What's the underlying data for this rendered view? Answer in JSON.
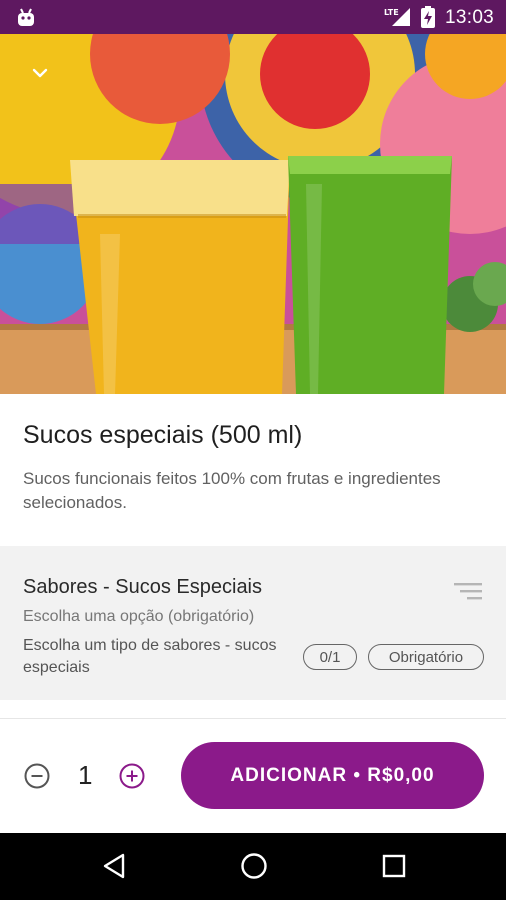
{
  "status_bar": {
    "time": "13:03",
    "network": "LTE",
    "icons": [
      "android-icon",
      "lte-signal-icon",
      "battery-icon"
    ]
  },
  "hero": {
    "image": "two-glasses-of-juice-photo",
    "collapse_icon": "chevron-down-icon"
  },
  "product": {
    "title": "Sucos especiais (500 ml)",
    "description": "Sucos funcionais feitos 100% com frutas e ingredientes selecionados."
  },
  "option_group": {
    "title": "Sabores - Sucos Especiais",
    "subtitle": "Escolha uma opção (obrigatório)",
    "description": "Escolha um tipo de sabores - sucos especiais",
    "count": "0/1",
    "required_badge": "Obrigatório",
    "icon": "filter-list-icon"
  },
  "footer": {
    "quantity": "1",
    "add_button_label": "ADICIONAR • R$0,00",
    "minus_icon": "minus-circle-icon",
    "plus_icon": "plus-circle-icon"
  },
  "colors": {
    "status_bar": "#5e1860",
    "accent": "#8b1a8a",
    "group_background": "#f2f2f2"
  },
  "navigation": {
    "icons": [
      "back-icon",
      "home-icon",
      "recents-icon"
    ]
  }
}
